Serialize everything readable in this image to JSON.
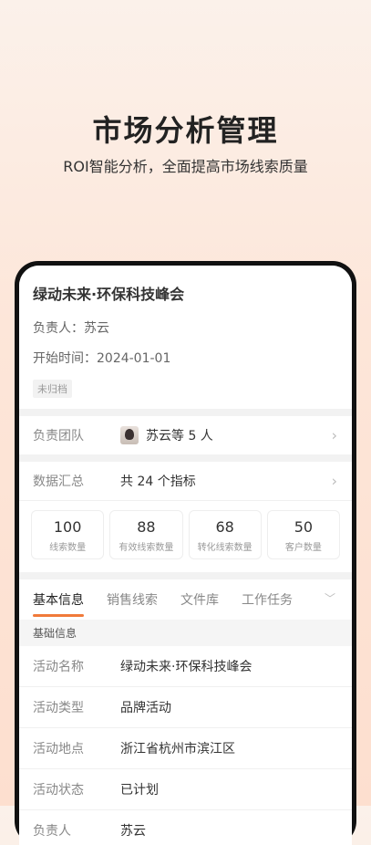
{
  "hero": {
    "title": "市场分析管理",
    "subtitle": "ROI智能分析，全面提高市场线索质量"
  },
  "event": {
    "title": "绿动未来·环保科技峰会",
    "owner_line": "负责人：苏云",
    "start_line": "开始时间：2024-01-01",
    "status_badge": "未归档"
  },
  "team": {
    "label": "负责团队",
    "value": "苏云等 5 人"
  },
  "summary": {
    "label": "数据汇总",
    "value": "共 24 个指标",
    "stats": [
      {
        "value": "100",
        "label": "线索数量"
      },
      {
        "value": "88",
        "label": "有效线索数量"
      },
      {
        "value": "68",
        "label": "转化线索数量"
      },
      {
        "value": "50",
        "label": "客户数量"
      }
    ]
  },
  "tabs": [
    "基本信息",
    "销售线索",
    "文件库",
    "工作任务"
  ],
  "basic_info": {
    "section_title": "基础信息",
    "rows": [
      {
        "label": "活动名称",
        "value": "绿动未来·环保科技峰会"
      },
      {
        "label": "活动类型",
        "value": "品牌活动"
      },
      {
        "label": "活动地点",
        "value": "浙江省杭州市滨江区"
      },
      {
        "label": "活动状态",
        "value": "已计划"
      },
      {
        "label": "负责人",
        "value": "苏云"
      }
    ]
  },
  "colors": {
    "accent": "#f07a3a"
  }
}
